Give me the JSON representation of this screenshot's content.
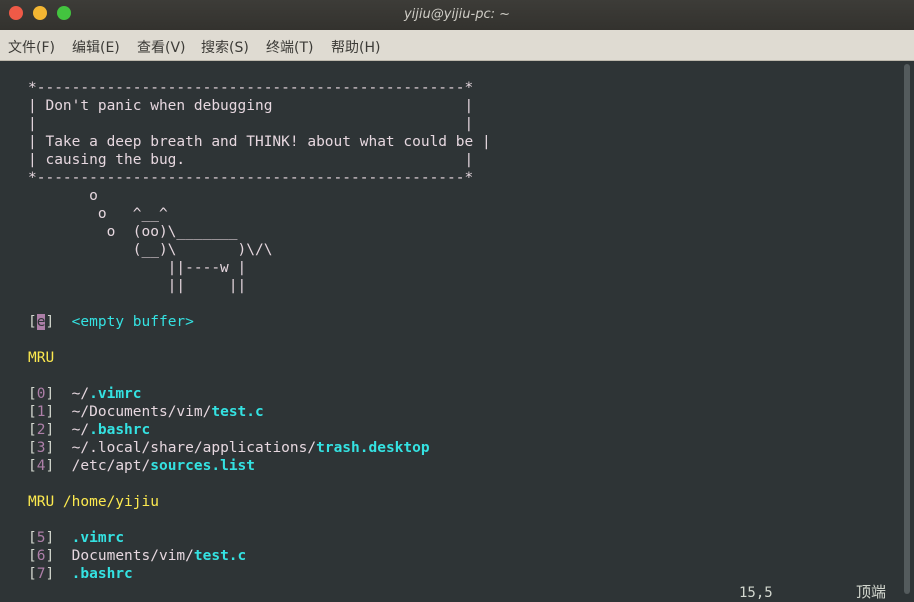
{
  "window": {
    "title": "yijiu@yijiu-pc: ~"
  },
  "menu": [
    "文件(F)",
    "编辑(E)",
    "查看(V)",
    "搜索(S)",
    "终端(T)",
    "帮助(H)"
  ],
  "cowsay": {
    "lines": [
      "*-------------------------------------------------*",
      "| Don't panic when debugging                      |",
      "|                                                 |",
      "| Take a deep breath and THINK! about what could be |",
      "| causing the bug.                                |",
      "*-------------------------------------------------*",
      "       o",
      "        o   ^__^",
      "         o  (oo)\\_______",
      "            (__)\\       )\\/\\",
      "                ||----w |",
      "                ||     ||"
    ]
  },
  "startify": {
    "empty_entry": {
      "key": "e",
      "label": "<empty buffer>"
    },
    "mru_header": "MRU",
    "mru": [
      {
        "key": "0",
        "dir": "~/",
        "file": ".vimrc"
      },
      {
        "key": "1",
        "dir": "~/Documents/vim/",
        "file": "test.c"
      },
      {
        "key": "2",
        "dir": "~/",
        "file": ".bashrc"
      },
      {
        "key": "3",
        "dir": "~/.local/share/applications/",
        "file": "trash.desktop"
      },
      {
        "key": "4",
        "dir": "/etc/apt/",
        "file": "sources.list"
      }
    ],
    "mru_dir_header": "MRU /home/yijiu",
    "mru_dir": [
      {
        "key": "5",
        "dir": "",
        "file": ".vimrc"
      },
      {
        "key": "6",
        "dir": "Documents/vim/",
        "file": "test.c"
      },
      {
        "key": "7",
        "dir": "",
        "file": ".bashrc"
      }
    ]
  },
  "status": {
    "position": "15,5",
    "scroll": "顶端"
  },
  "colors": {
    "background": "#2e3436",
    "cyan": "#34e2e2",
    "yellow": "#fce94f",
    "pink": "#ad7fa8"
  }
}
